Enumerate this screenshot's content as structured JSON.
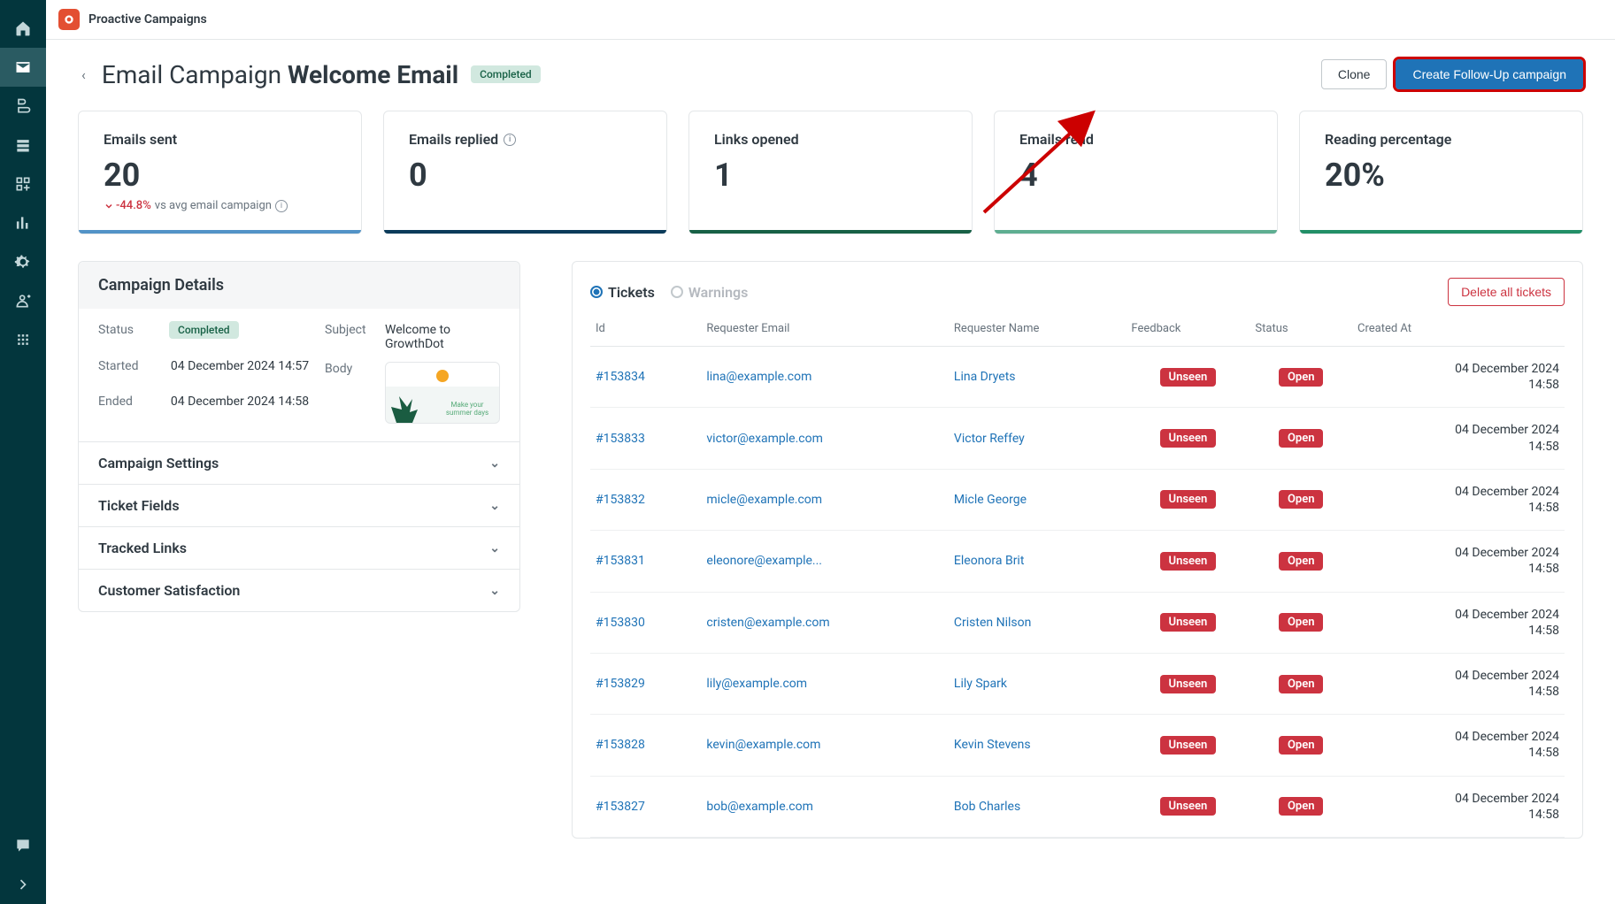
{
  "app": {
    "name": "Proactive Campaigns"
  },
  "header": {
    "title_prefix": "Email Campaign",
    "title_main": "Welcome Email",
    "status": "Completed",
    "clone_label": "Clone",
    "followup_label": "Create Follow-Up campaign"
  },
  "stats": {
    "sent": {
      "label": "Emails sent",
      "value": "20",
      "delta_pct": "-44.8%",
      "delta_suffix": "vs avg email campaign"
    },
    "replied": {
      "label": "Emails replied",
      "value": "0"
    },
    "links": {
      "label": "Links opened",
      "value": "1"
    },
    "read": {
      "label": "Emails read",
      "value": "4"
    },
    "pct": {
      "label": "Reading percentage",
      "value": "20%"
    }
  },
  "details": {
    "heading": "Campaign Details",
    "labels": {
      "status": "Status",
      "started": "Started",
      "ended": "Ended",
      "subject": "Subject",
      "body": "Body"
    },
    "status": "Completed",
    "started": "04 December 2024 14:57",
    "ended": "04 December 2024 14:58",
    "subject": "Welcome to GrowthDot",
    "preview_caption": "Make your summer days"
  },
  "accordion": {
    "settings": "Campaign Settings",
    "fields": "Ticket Fields",
    "links": "Tracked Links",
    "csat": "Customer Satisfaction"
  },
  "tickets_panel": {
    "tab_tickets": "Tickets",
    "tab_warnings": "Warnings",
    "delete_all": "Delete all tickets",
    "columns": {
      "id": "Id",
      "email": "Requester Email",
      "name": "Requester Name",
      "feedback": "Feedback",
      "status": "Status",
      "created": "Created At"
    },
    "badge_unseen": "Unseen",
    "badge_open": "Open",
    "rows": [
      {
        "id": "#153834",
        "email": "lina@example.com",
        "name": "Lina Dryets",
        "created_date": "04 December 2024",
        "created_time": "14:58"
      },
      {
        "id": "#153833",
        "email": "victor@example.com",
        "name": "Victor Reffey",
        "created_date": "04 December 2024",
        "created_time": "14:58"
      },
      {
        "id": "#153832",
        "email": "micle@example.com",
        "name": "Micle George",
        "created_date": "04 December 2024",
        "created_time": "14:58"
      },
      {
        "id": "#153831",
        "email": "eleonore@example...",
        "name": "Eleonora Brit",
        "created_date": "04 December 2024",
        "created_time": "14:58"
      },
      {
        "id": "#153830",
        "email": "cristen@example.com",
        "name": "Cristen Nilson",
        "created_date": "04 December 2024",
        "created_time": "14:58"
      },
      {
        "id": "#153829",
        "email": "lily@example.com",
        "name": "Lily Spark",
        "created_date": "04 December 2024",
        "created_time": "14:58"
      },
      {
        "id": "#153828",
        "email": "kevin@example.com",
        "name": "Kevin Stevens",
        "created_date": "04 December 2024",
        "created_time": "14:58"
      },
      {
        "id": "#153827",
        "email": "bob@example.com",
        "name": "Bob Charles",
        "created_date": "04 December 2024",
        "created_time": "14:58"
      }
    ]
  }
}
